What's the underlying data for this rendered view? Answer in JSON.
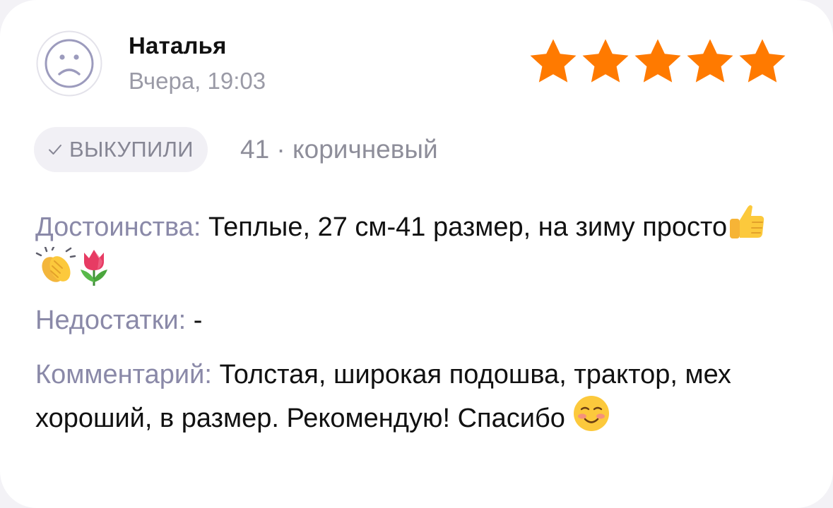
{
  "review": {
    "author": "Наталья",
    "date": "Вчера, 19:03",
    "rating": 5,
    "rating_max": 5,
    "star_color": "#ff7a00",
    "badge": "ВЫКУПИЛИ",
    "variant": "41 · коричневый"
  },
  "pros": {
    "label": "Достоинства:",
    "text": " Теплые, 27 см-41 размер, на зиму просто"
  },
  "cons": {
    "label": "Недостатки:",
    "text": " -"
  },
  "comment": {
    "label": "Комментарий:",
    "text": " Толстая, широкая подошва, трактор, мех хороший, в размер. Рекомендую! Спасибо "
  },
  "icons": {
    "avatar": "user-avatar-icon",
    "badge": "checkmark-icon",
    "pros_emojis": [
      "thumbs-up-emoji",
      "clapping-hands-emoji",
      "tulip-emoji"
    ],
    "comment_emoji": "smiling-face-emoji"
  },
  "colors": {
    "accent_label": "#8a89a8",
    "muted_text": "#9a9aa6",
    "badge_background": "#f1f0f5"
  }
}
